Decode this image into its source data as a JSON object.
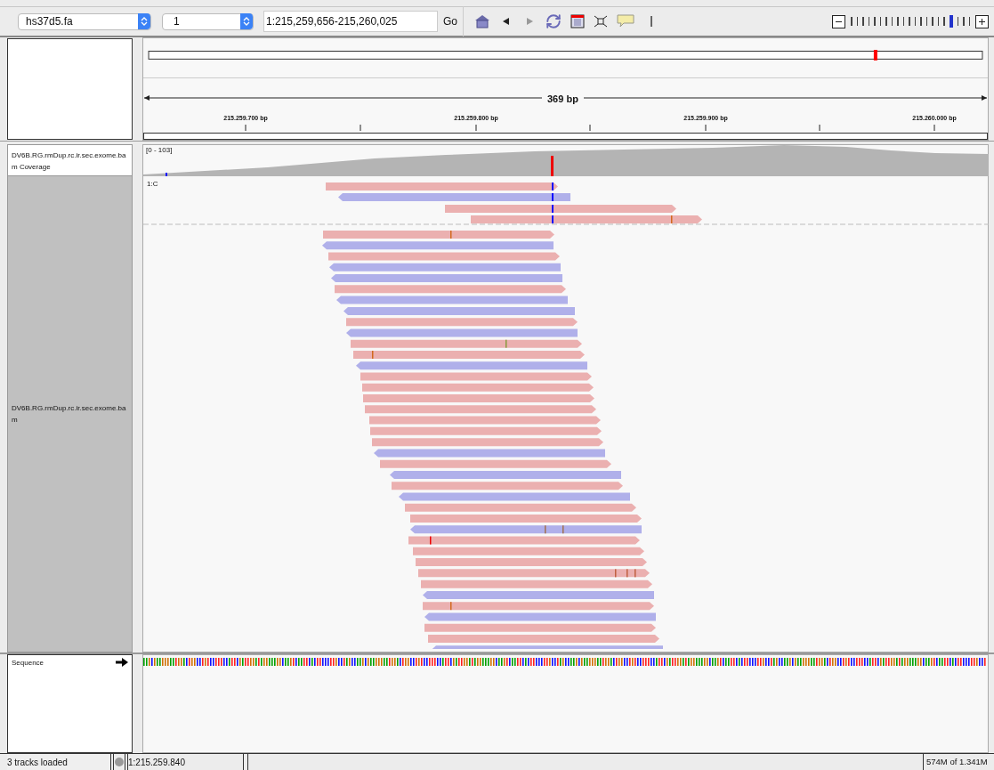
{
  "toolbar": {
    "genome": "hs37d5.fa",
    "chromosome": "1",
    "locus": "1:215,259,656-215,260,025",
    "go_button": "Go",
    "zoom": {
      "level": 0.85
    }
  },
  "ruler": {
    "span": "369 bp",
    "ticks": [
      "215.259.700 bp",
      "215.259.800 bp",
      "215.259.900 bp",
      "215.260.000 bp"
    ]
  },
  "tracks": [
    {
      "kind": "coverage",
      "name": "DV6B.RG.rmDup.rc.ir.sec.exome.bam Coverage",
      "range": "[0 - 103]"
    },
    {
      "kind": "alignment",
      "name": "DV6B.RG.rmDup.rc.ir.sec.exome.bam",
      "group_label": "1:C"
    }
  ],
  "sequence_track": {
    "name": "Sequence"
  },
  "status_bar": {
    "message": "3 tracks loaded",
    "position": "1:215.259.840",
    "memory": "574M of 1.341M"
  }
}
